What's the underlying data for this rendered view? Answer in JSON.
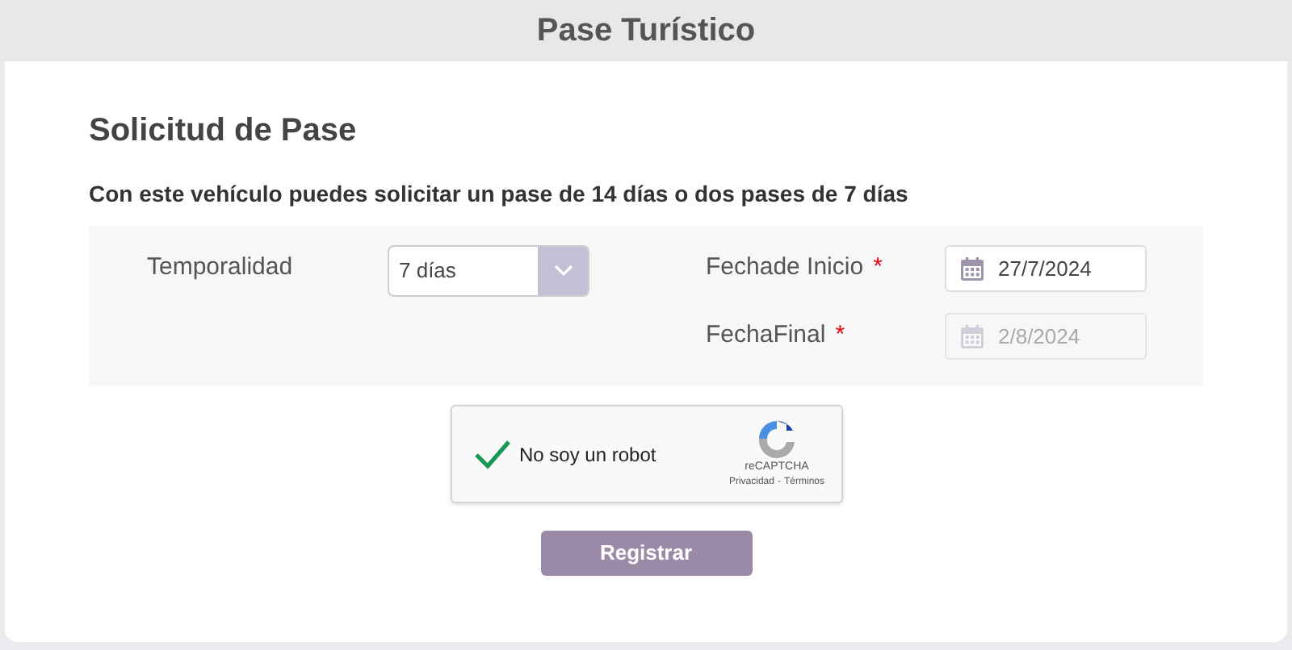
{
  "header": {
    "title": "Pase Turístico"
  },
  "form": {
    "title": "Solicitud de Pase",
    "description": "Con este vehículo puedes solicitar un pase de 14 días o dos pases de 7 días",
    "temporalidad": {
      "label": "Temporalidad",
      "value": "7 días"
    },
    "fields": [
      {
        "label": "Fechade Inicio",
        "required_mark": "*",
        "value": "27/7/2024",
        "disabled": false
      },
      {
        "label": "FechaFinal",
        "required_mark": "*",
        "value": "2/8/2024",
        "disabled": true
      }
    ],
    "captcha": {
      "label": "No soy un robot",
      "checked": true,
      "brand": "reCAPTCHA",
      "links": [
        "Privacidad",
        "Términos"
      ],
      "separator": "-"
    },
    "submit": {
      "label": "Registrar",
      "disabled": true
    }
  }
}
